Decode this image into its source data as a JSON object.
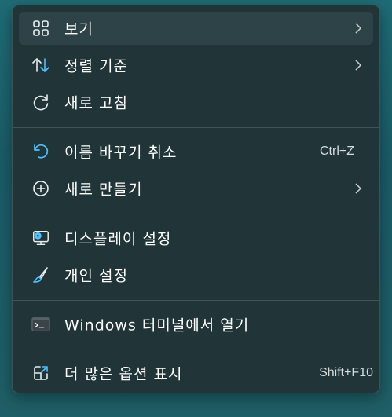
{
  "menu": {
    "items": [
      {
        "label": "보기",
        "icon": "grid-view-icon",
        "submenu": true
      },
      {
        "label": "정렬 기준",
        "icon": "sort-arrows-icon",
        "submenu": true
      },
      {
        "label": "새로 고침",
        "icon": "refresh-icon",
        "submenu": false
      },
      {
        "label": "이름 바꾸기 취소",
        "icon": "undo-icon",
        "accelerator": "Ctrl+Z"
      },
      {
        "label": "새로 만들기",
        "icon": "add-circle-icon",
        "submenu": true
      },
      {
        "label": "디스플레이 설정",
        "icon": "display-settings-icon"
      },
      {
        "label": "개인 설정",
        "icon": "brush-icon"
      },
      {
        "label": "Windows 터미널에서 열기",
        "icon": "terminal-icon"
      },
      {
        "label": "더 많은 옵션 표시",
        "icon": "show-more-options-icon",
        "accelerator": "Shift+F10"
      }
    ]
  },
  "colors": {
    "accent": "#4cc2ff",
    "menu_background": "#213539",
    "hover_background": "#2e4347",
    "text": "#ffffff"
  }
}
